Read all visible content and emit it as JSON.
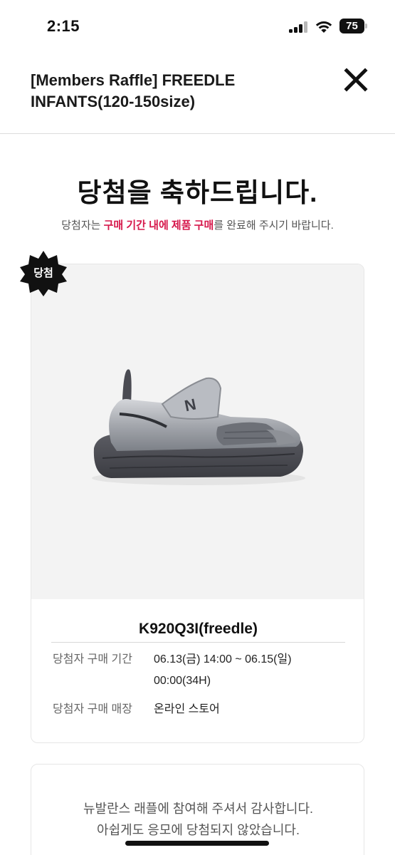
{
  "status_bar": {
    "time": "2:15",
    "battery": "75"
  },
  "header": {
    "title": "[Members Raffle] FREEDLE INFANTS(120-150size)"
  },
  "main": {
    "headline": "당첨을 축하드립니다.",
    "subtext_pre": "당첨자는 ",
    "subtext_highlight": "구매 기간 내에 제품 구매",
    "subtext_post": "를 완료해 주시기 바랍니다.",
    "highlight_color": "#d6184b"
  },
  "winner_card": {
    "badge": "당첨",
    "product_name": "K920Q3I(freedle)",
    "purchase_period_label": "당첨자 구매 기간",
    "purchase_period_value": "06.13(금) 14:00 ~ 06.15(일) 00:00(34H)",
    "purchase_store_label": "당첨자 구매 매장",
    "purchase_store_value": "온라인 스토어"
  },
  "thanks_card": {
    "line1": "뉴발란스 래플에 참여해 주셔서 감사합니다.",
    "line2": "아쉽게도 응모에 당첨되지 않았습니다."
  }
}
